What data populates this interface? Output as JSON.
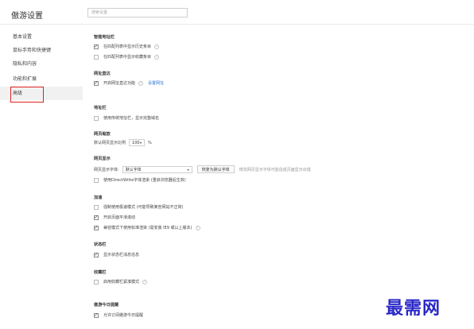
{
  "header": {
    "title": "傲游设置",
    "search_placeholder": "搜索设置"
  },
  "sidebar": {
    "items": [
      {
        "label": "基本设置"
      },
      {
        "label": "鼠标手势和快捷键"
      },
      {
        "label": "隐私和内容"
      },
      {
        "label": "功能和扩展"
      },
      {
        "label": "高级"
      }
    ],
    "active_index": 4
  },
  "sections": {
    "smart_address_bar": {
      "title": "智能地址栏",
      "opt1": "在匹配列表中显示历史条目",
      "opt2": "在匹配列表中显示收藏条目"
    },
    "direct_url": {
      "title": "网址直达",
      "opt1": "开启网址直达功能",
      "link": "设置网址"
    },
    "address_bar": {
      "title": "地址栏",
      "opt1": "使用传统地址栏，显示完整域名"
    },
    "page_zoom": {
      "title": "网页缩放",
      "label": "默认网页显示比例",
      "value": "100",
      "unit": "%"
    },
    "page_display": {
      "title": "网页显示",
      "font_label": "网页显示字体:",
      "font_value": "默认字体",
      "reset_button": "恢复为默认字体",
      "hint": "修改网页显示字体可能造成页面显示出错",
      "opt1": "使用DirectWrite字体渲染 (重启浏览器后生效)"
    },
    "speed": {
      "title": "加速",
      "opt1": "强制使用极速模式 (可能导致某些网站不正常)",
      "opt2": "开启页面平滑滚动",
      "opt3": "兼容模式下使用标准渲染 (需安装 IE9 或以上版本)"
    },
    "status_bar": {
      "title": "状态栏",
      "opt1": "显示状态栏消息信息"
    },
    "favorites_bar": {
      "title": "收藏栏",
      "opt1": "启用收藏栏紧凑模式"
    },
    "maxthon_today": {
      "title": "傲游今日提醒",
      "opt1": "允许订阅傲游今日提醒"
    }
  },
  "watermark": "最需网"
}
